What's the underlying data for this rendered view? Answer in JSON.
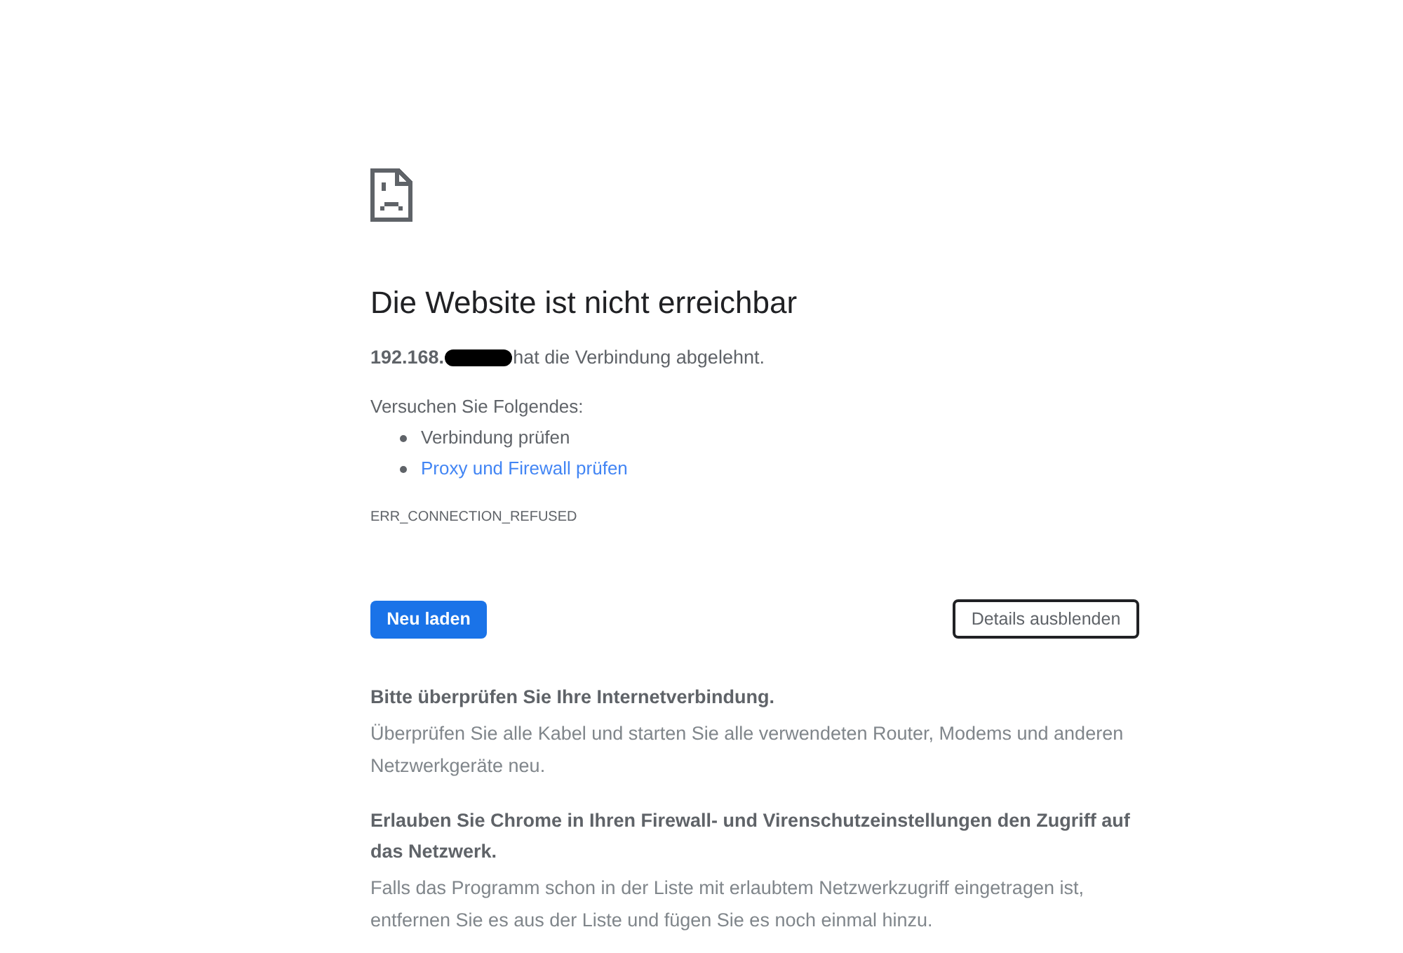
{
  "error_page": {
    "title": "Die Website ist nicht erreichbar",
    "message": {
      "host": "192.168.",
      "redacted": true,
      "text": "hat die Verbindung abgelehnt."
    },
    "suggestions": {
      "heading": "Versuchen Sie Folgendes:",
      "items": [
        {
          "label": "Verbindung prüfen",
          "kind": "text"
        },
        {
          "label": "Proxy und Firewall prüfen",
          "kind": "link"
        }
      ]
    },
    "error_code": "ERR_CONNECTION_REFUSED"
  },
  "buttons": [
    {
      "label": "Neu laden",
      "kind": "primary"
    },
    {
      "label": "Details ausblenden",
      "kind": "secondary"
    }
  ],
  "details": [
    {
      "heading": "Bitte überprüfen Sie Ihre Internetverbindung.",
      "text": "Überprüfen Sie alle Kabel und starten Sie alle verwendeten Router, Modems und anderen Netzwerkgeräte neu."
    },
    {
      "heading": "Erlauben Sie Chrome in Ihren Firewall- und Virenschutzeinstellungen den Zugriff auf das Netzwerk.",
      "text": "Falls das Programm schon in der Liste mit erlaubtem Netzwerkzugriff eingetragen ist, entfernen Sie es aus der Liste und fügen Sie es noch einmal hinzu."
    }
  ]
}
